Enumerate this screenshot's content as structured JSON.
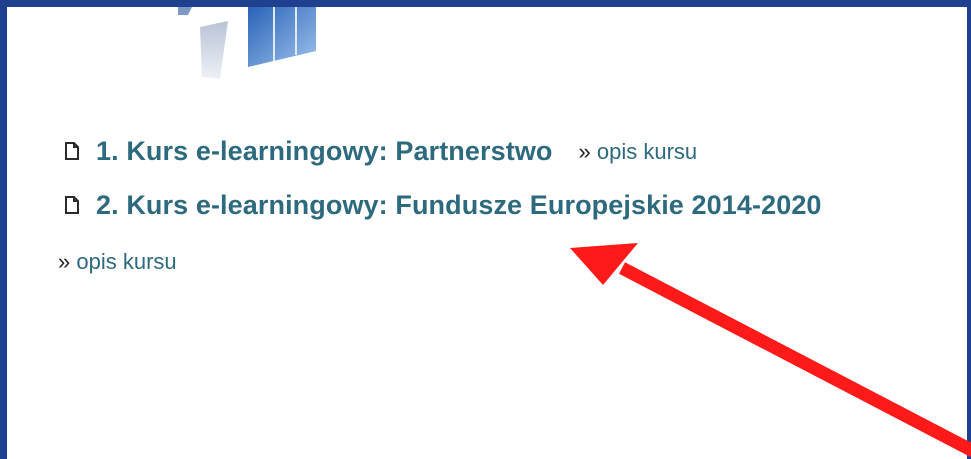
{
  "courses": [
    {
      "title": "1. Kurs e-learningowy: Partnerstwo",
      "desc_prefix": "»",
      "desc_label": "opis kursu"
    },
    {
      "title": "2. Kurs e-learningowy: Fundusze Europejskie 2014-2020",
      "desc_prefix": "»",
      "desc_label": "opis kursu"
    }
  ],
  "colors": {
    "link": "#2e6a7e",
    "frame": "#1f3f8f",
    "annotation_arrow": "#ff1a1a"
  },
  "icons": {
    "course_icon": "document-icon",
    "logo": "logo-graphic",
    "annotation": "red-arrow-annotation"
  }
}
